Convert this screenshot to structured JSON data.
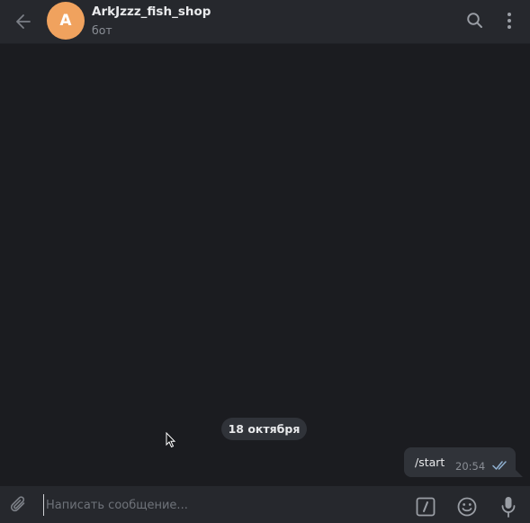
{
  "header": {
    "back_icon": "arrow-left-icon",
    "avatar_letter": "A",
    "avatar_color": "#f0a25e",
    "title": "ArkJzzz_fish_shop",
    "subtitle": "бот",
    "search_icon": "search-icon",
    "menu_icon": "more-vertical-icon"
  },
  "messages": {
    "date_separator": "18 октября",
    "items": [
      {
        "text": "/start",
        "time": "20:54",
        "status": "read",
        "outgoing": true
      }
    ]
  },
  "composer": {
    "placeholder": "Написать сообщение...",
    "value": "",
    "attach_icon": "paperclip-icon",
    "commands_icon": "bot-commands-icon",
    "emoji_icon": "emoji-icon",
    "mic_icon": "microphone-icon"
  },
  "colors": {
    "background": "#1b1c20",
    "header": "#26282d",
    "bubble": "#303339",
    "accent_check": "#7fb3e0"
  }
}
